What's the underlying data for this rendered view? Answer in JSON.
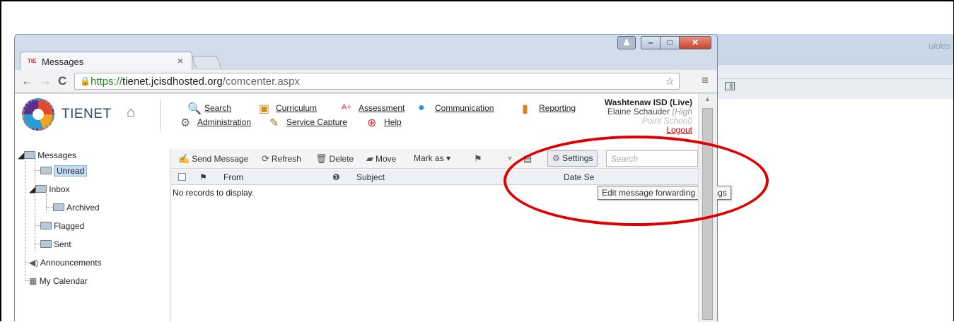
{
  "background_window": {
    "partial_text": "uides"
  },
  "browser": {
    "tab_title": "Messages",
    "tab_favicon": "tienet-favicon",
    "tab_close": "×",
    "url_https": "https://",
    "url_host": "tienet.jcisdhosted.org",
    "url_path": "/comcenter.aspx"
  },
  "app": {
    "brand": "TIENET",
    "nav": {
      "search": "Search",
      "curriculum": "Curriculum",
      "assessment": "Assessment",
      "communication": "Communication",
      "reporting": "Reporting",
      "administration": "Administration",
      "service_capture": "Service Capture",
      "help": "Help"
    },
    "user": {
      "org": "Washtenaw ISD (Live)",
      "name": "Elaine Schauder",
      "school_part1": "(High",
      "school_part2": "Point School)",
      "logout": "Logout"
    }
  },
  "tree": {
    "messages": "Messages",
    "unread": "Unread",
    "inbox": "Inbox",
    "archived": "Archived",
    "flagged": "Flagged",
    "sent": "Sent",
    "announcements": "Announcements",
    "calendar": "My Calendar"
  },
  "grid": {
    "toolbar": {
      "send": "Send Message",
      "refresh": "Refresh",
      "delete": "Delete",
      "move": "Move",
      "mark_as": "Mark as",
      "settings": "Settings",
      "search_placeholder": "Search"
    },
    "columns": {
      "from": "From",
      "subject": "Subject",
      "date_sent": "Date Se"
    },
    "empty_message": "No records to display.",
    "tooltip": "Edit message forwarding settings"
  },
  "colors": {
    "highlight_ellipse": "#e10000",
    "logout": "#d40000",
    "selection": "#c3dbf3"
  }
}
